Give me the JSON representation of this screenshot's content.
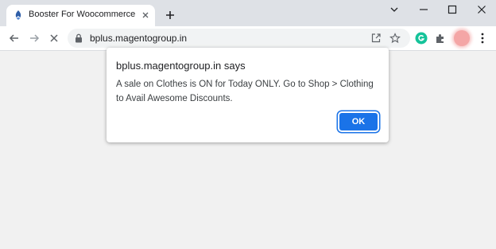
{
  "browser": {
    "tab": {
      "title": "Booster For Woocommerce"
    },
    "toolbar": {
      "url": "bplus.magentogroup.in"
    },
    "colors": {
      "accent": "#1a73e8",
      "grammarly": "#15c39a"
    },
    "icons": [
      "booster-favicon-icon",
      "close-icon",
      "plus-icon",
      "minimize-icon",
      "maximize-icon",
      "close-window-icon",
      "chevron-down-icon",
      "back-arrow-icon",
      "forward-arrow-icon",
      "stop-loading-icon",
      "lock-icon",
      "share-icon",
      "star-icon",
      "grammarly-icon",
      "puzzle-icon",
      "kebab-menu-icon"
    ]
  },
  "dialog": {
    "title": "bplus.magentogroup.in says",
    "message": "A sale on Clothes is ON for Today ONLY. Go to Shop > Clothing to Avail Awesome Discounts.",
    "ok_label": "OK"
  }
}
